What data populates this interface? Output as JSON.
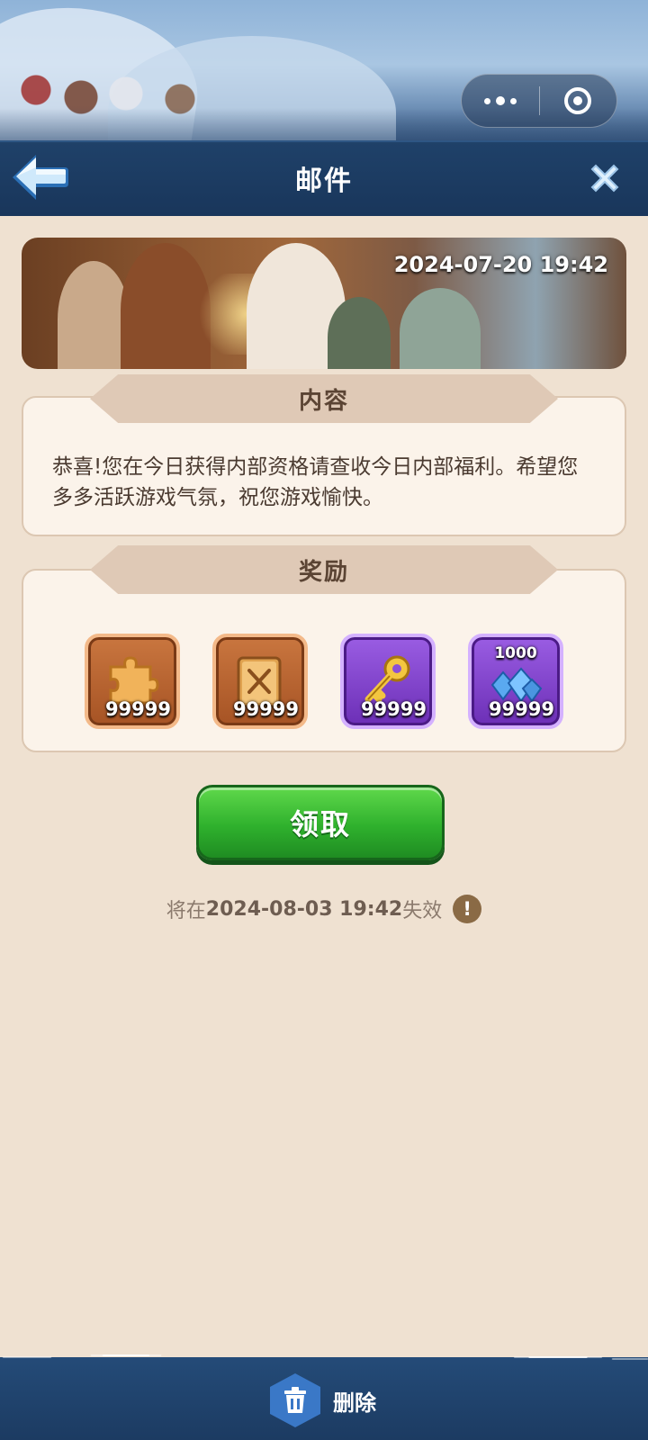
{
  "header": {
    "title": "邮件"
  },
  "mail": {
    "date": "2024-07-20 19:42",
    "content_title": "内容",
    "content_text": "恭喜!您在今日获得内部资格请查收今日内部福利。希望您多多活跃游戏气氛，祝您游戏愉快。",
    "reward_title": "奖励",
    "rewards": [
      {
        "icon": "puzzle-piece-icon",
        "quantity": "99999",
        "color": "#c9763f"
      },
      {
        "icon": "book-icon",
        "quantity": "99999",
        "color": "#c9763f"
      },
      {
        "icon": "golden-key-icon",
        "quantity": "99999",
        "color": "#8b4fd6"
      },
      {
        "icon": "blue-gems-icon",
        "top_count": "1000",
        "quantity": "99999",
        "color": "#8b4fd6"
      }
    ],
    "claim_label": "领取",
    "expire_prefix": "将在",
    "expire_date": "2024-08-03 19:42",
    "expire_suffix": "失效"
  },
  "footer": {
    "delete_label": "删除"
  },
  "colors": {
    "accent_green": "#2fb12d",
    "header_blue": "#1f4169",
    "background": "#efe1d1"
  }
}
